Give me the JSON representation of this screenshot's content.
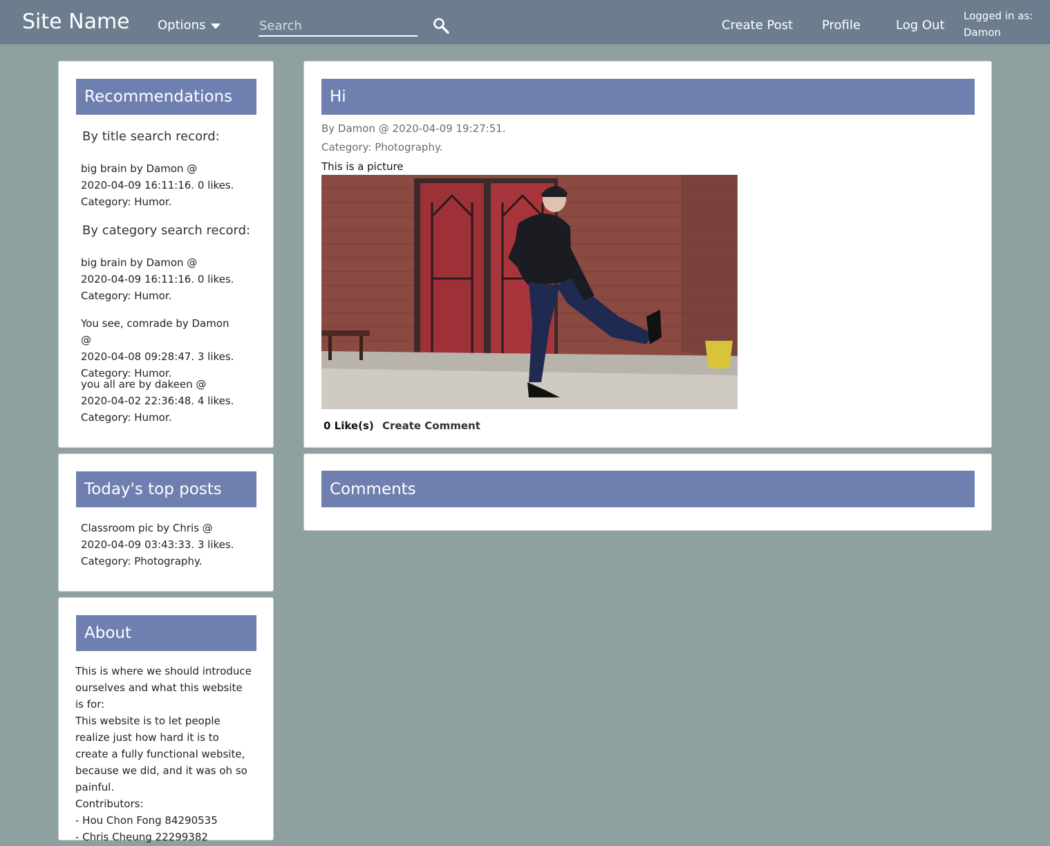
{
  "header": {
    "site_name": "Site Name",
    "options_label": "Options",
    "search_placeholder": "Search",
    "create_post": "Create Post",
    "profile": "Profile",
    "log_out": "Log Out",
    "logged_in_label": "Logged in as:",
    "username": "Damon"
  },
  "recommendations": {
    "title": "Recommendations",
    "by_title_label": "By title search record:",
    "by_title_items": [
      {
        "line1": "big brain by Damon @",
        "line2": "2020-04-09 16:11:16. 0 likes.",
        "line3": "Category: Humor."
      }
    ],
    "by_category_label": "By category search record:",
    "by_category_items": [
      {
        "line1": "big brain by Damon @",
        "line2": "2020-04-09 16:11:16. 0 likes.",
        "line3": "Category: Humor."
      },
      {
        "line1": "You see, comrade by Damon @",
        "line2": "2020-04-08 09:28:47. 3 likes.",
        "line3": "Category: Humor."
      },
      {
        "line1": "you all are by dakeen @",
        "line2": "2020-04-02 22:36:48. 4 likes.",
        "line3": "Category: Humor."
      }
    ]
  },
  "top_posts": {
    "title": "Today's top posts",
    "items": [
      {
        "line1": "Classroom pic by Chris @",
        "line2": "2020-04-09 03:43:33. 3 likes.",
        "line3": "Category: Photography."
      }
    ]
  },
  "about": {
    "title": "About",
    "lines": [
      "This is where we should introduce ourselves and what this website is for:",
      "This website is to let people realize just how hard it is to create a fully functional website, because we did, and it was oh so painful.",
      "Contributors:",
      "- Hou Chon Fong 84290535",
      "- Chris Cheung 22299382"
    ]
  },
  "post": {
    "title": "Hi",
    "byline": "By Damon @ 2020-04-09 19:27:51.",
    "category": "Category: Photography.",
    "body": "This is a picture",
    "likes": "0 Like(s)",
    "create_comment": "Create Comment",
    "image_icon": "photo-of-person-kicking-in-front-of-red-doors"
  },
  "comments": {
    "title": "Comments"
  },
  "colors": {
    "topbar": "#6c7d8e",
    "background": "#8fa0a0",
    "card_header": "#6f7fb0"
  }
}
